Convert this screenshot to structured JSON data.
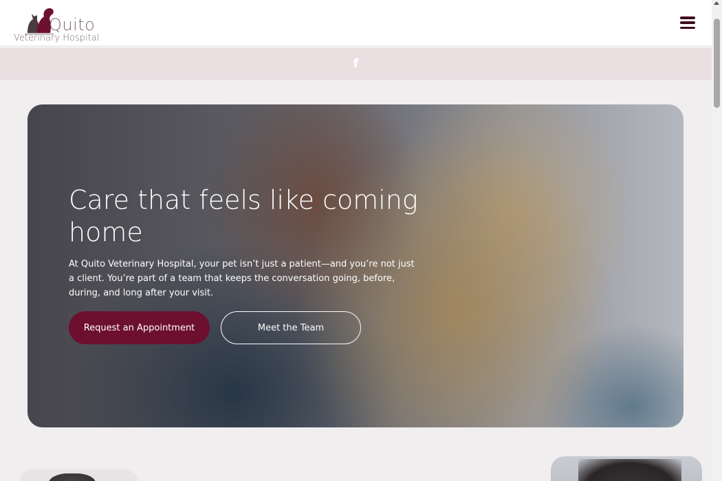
{
  "header": {
    "logo_name": "Quito",
    "logo_sub": "Veterinary Hospital",
    "logo_icon": "dog-cat-silhouette-icon",
    "menu_icon": "hamburger-menu-icon"
  },
  "social": {
    "facebook_icon": "f"
  },
  "hero": {
    "title": "Care that feels like coming home",
    "text": "At Quito Veterinary Hospital, your pet isn’t just a patient—and you’re not just a client. You’re part of a team that keeps the conversation going, before, during, and long after your visit.",
    "primary_button": "Request an Appointment",
    "secondary_button": "Meet the Team"
  },
  "colors": {
    "brand": "#6d0f2f",
    "social_bar": "#ebdfe2",
    "background": "#f0eeef"
  }
}
